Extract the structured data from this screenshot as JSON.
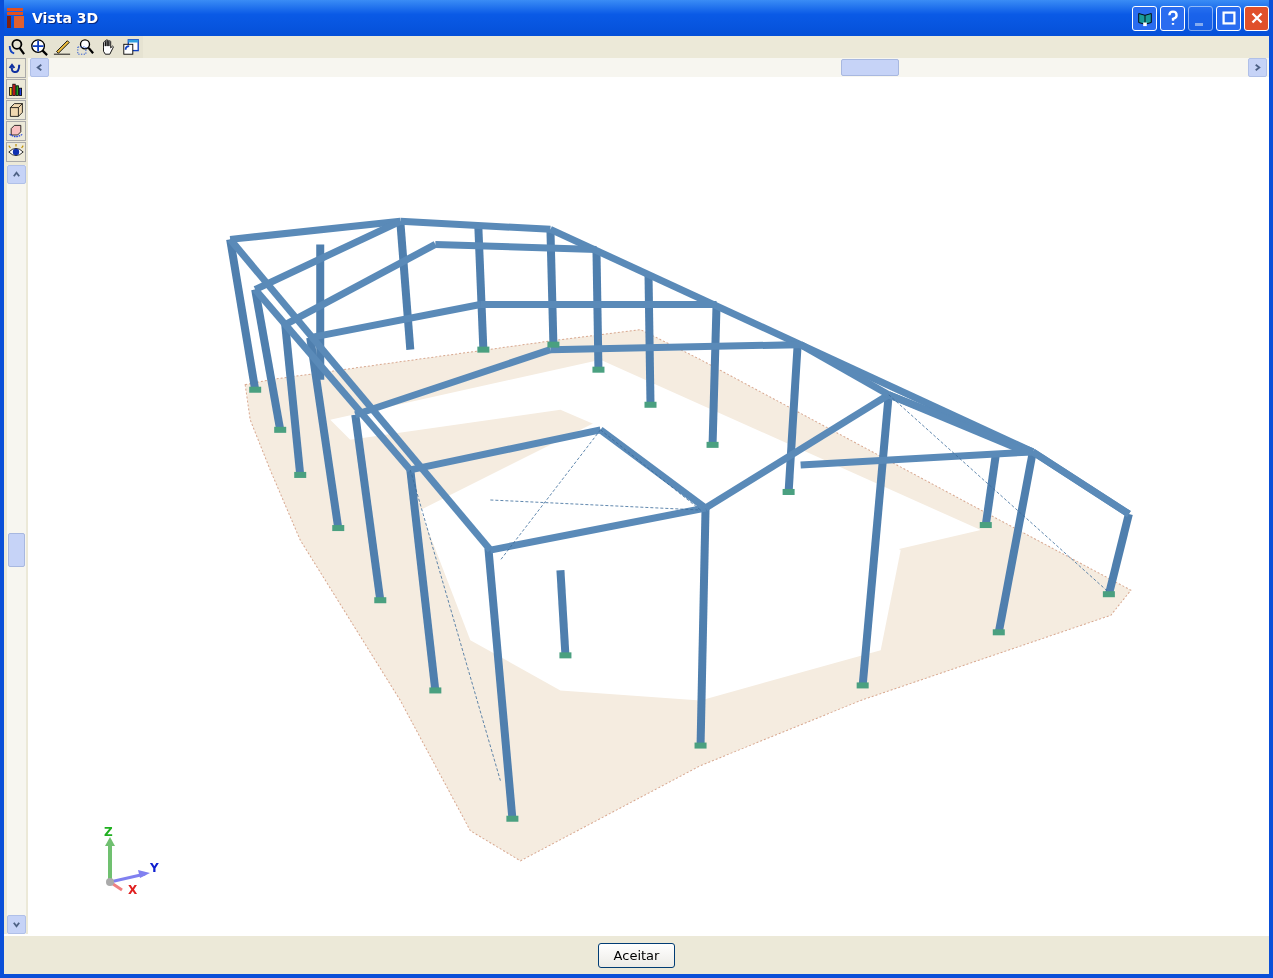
{
  "window": {
    "title": "Vista 3D"
  },
  "title_buttons": [
    {
      "kind": "book",
      "disabled": false
    },
    {
      "kind": "help",
      "disabled": false
    },
    {
      "kind": "minimize",
      "disabled": true
    },
    {
      "kind": "maximize",
      "disabled": false
    },
    {
      "kind": "close",
      "disabled": false
    }
  ],
  "top_toolbar": [
    {
      "kind": "rotate-magnifier"
    },
    {
      "kind": "zoom-extents"
    },
    {
      "kind": "pencil"
    },
    {
      "kind": "zoom-window"
    },
    {
      "kind": "hand"
    },
    {
      "kind": "window-copy"
    }
  ],
  "side_toolbar": [
    {
      "kind": "undo"
    },
    {
      "kind": "bar-chart"
    },
    {
      "kind": "cube"
    },
    {
      "kind": "cube-rotate"
    },
    {
      "kind": "eye"
    }
  ],
  "axes": {
    "z": "Z",
    "y": "Y",
    "x": "X"
  },
  "footer": {
    "button": "Aceitar"
  }
}
